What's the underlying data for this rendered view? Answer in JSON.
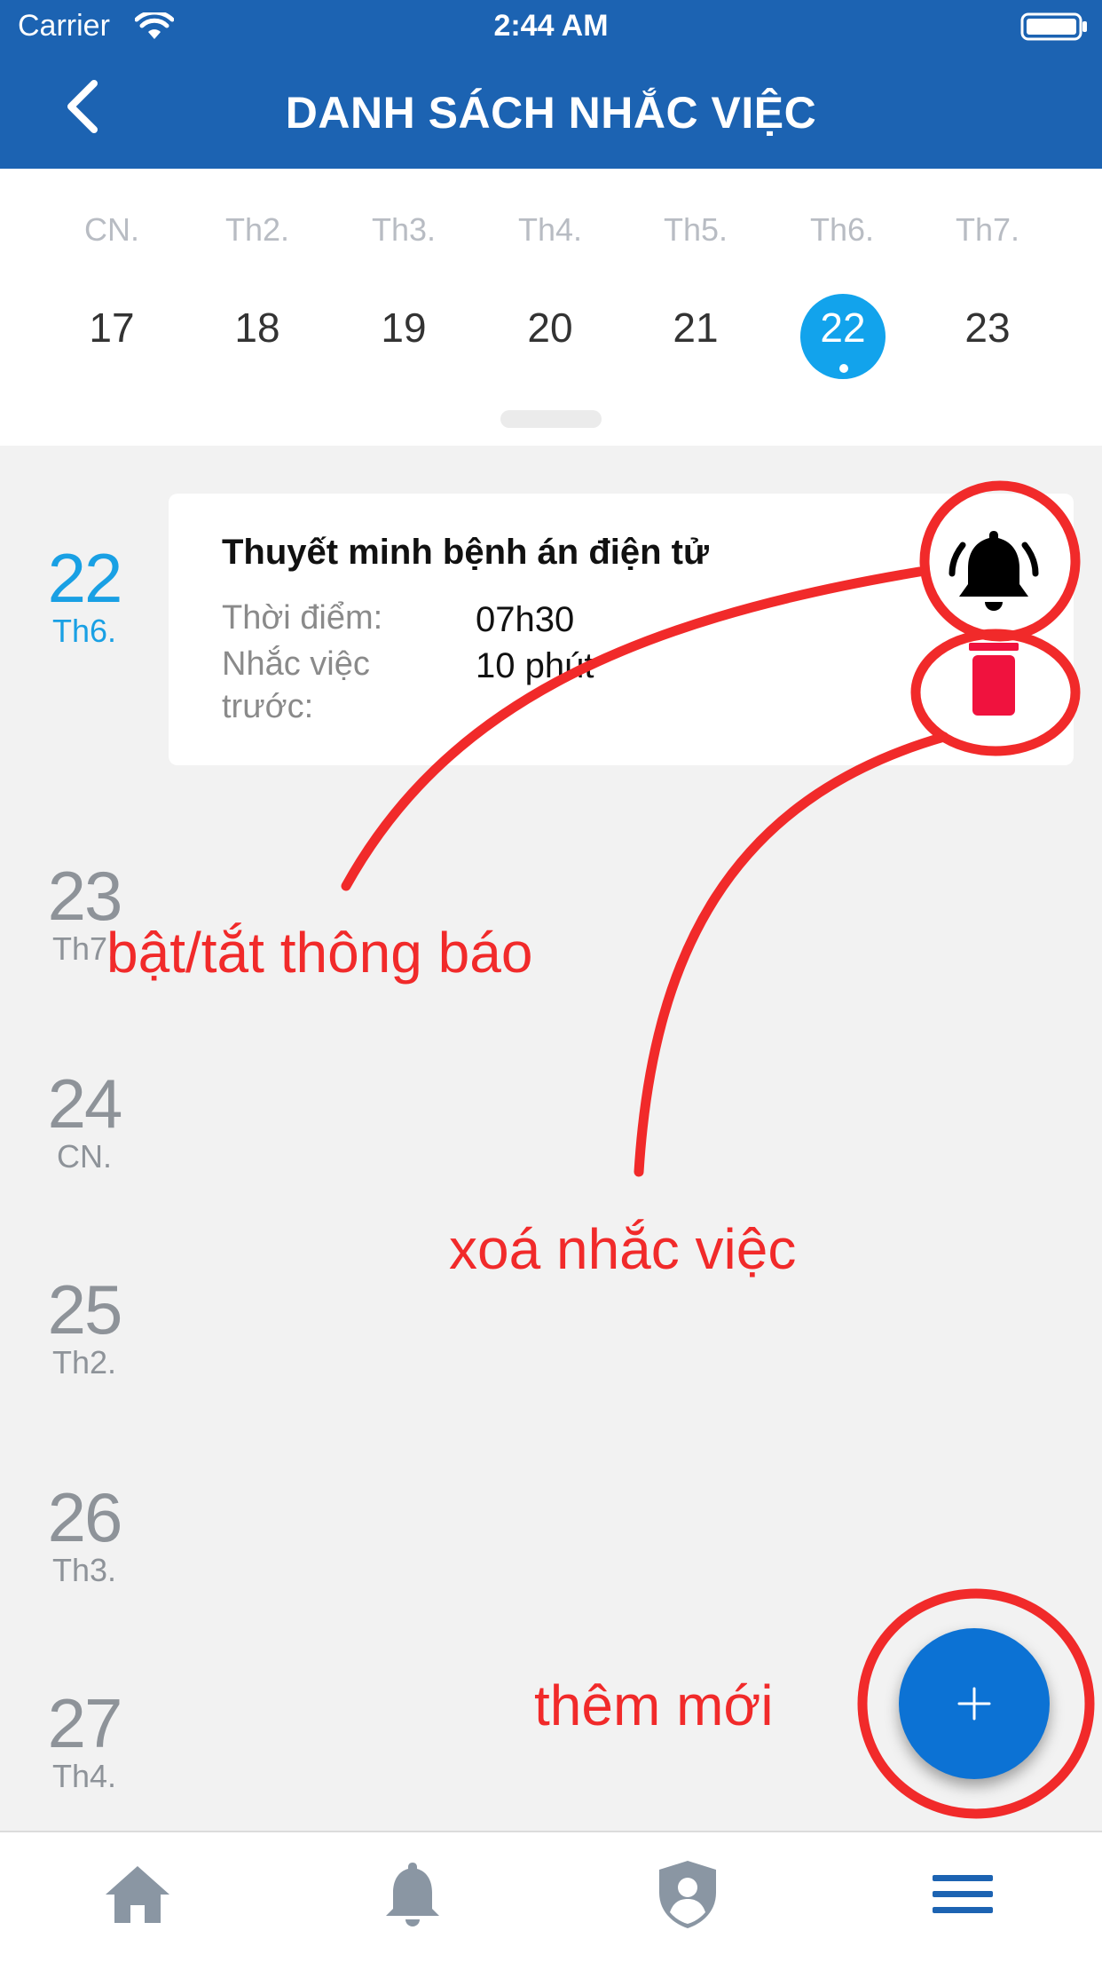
{
  "status_bar": {
    "carrier": "Carrier",
    "time": "2:44 AM"
  },
  "header": {
    "title": "DANH SÁCH NHẮC VIỆC",
    "back_icon": "chevron-left-icon"
  },
  "week": {
    "days": [
      {
        "weekday": "CN.",
        "date": "17"
      },
      {
        "weekday": "Th2.",
        "date": "18"
      },
      {
        "weekday": "Th3.",
        "date": "19"
      },
      {
        "weekday": "Th4.",
        "date": "20"
      },
      {
        "weekday": "Th5.",
        "date": "21"
      },
      {
        "weekday": "Th6.",
        "date": "22"
      },
      {
        "weekday": "Th7.",
        "date": "23"
      }
    ],
    "selected_date": "22",
    "selected_color": "#12a3ec"
  },
  "agenda": {
    "days": [
      {
        "date": "22",
        "weekday": "Th6."
      },
      {
        "date": "23",
        "weekday": "Th7."
      },
      {
        "date": "24",
        "weekday": "CN."
      },
      {
        "date": "25",
        "weekday": "Th2."
      },
      {
        "date": "26",
        "weekday": "Th3."
      },
      {
        "date": "27",
        "weekday": "Th4."
      }
    ]
  },
  "event": {
    "title": "Thuyết minh bệnh án điện tử",
    "time_label": "Thời điểm:",
    "time_value": "07h30",
    "remind_label_line1": "Nhắc việc",
    "remind_label_line2": "trước:",
    "remind_value": "10 phút",
    "bell_icon": "bell-ringing-icon",
    "delete_icon": "trash-icon"
  },
  "annotations": {
    "toggle_notification": "bật/tắt thông báo",
    "delete_reminder": "xoá nhắc việc",
    "add_new": "thêm mới",
    "color": "#f12a2a"
  },
  "fab": {
    "icon": "plus-icon",
    "color": "#0c72d4"
  },
  "tab_bar": {
    "items": [
      {
        "icon": "home-icon"
      },
      {
        "icon": "bell-icon"
      },
      {
        "icon": "shield-user-icon"
      },
      {
        "icon": "menu-icon",
        "active": true
      }
    ],
    "active_color": "#1c63b2"
  },
  "colors": {
    "header": "#1c63b2",
    "background": "#f2f2f2"
  }
}
